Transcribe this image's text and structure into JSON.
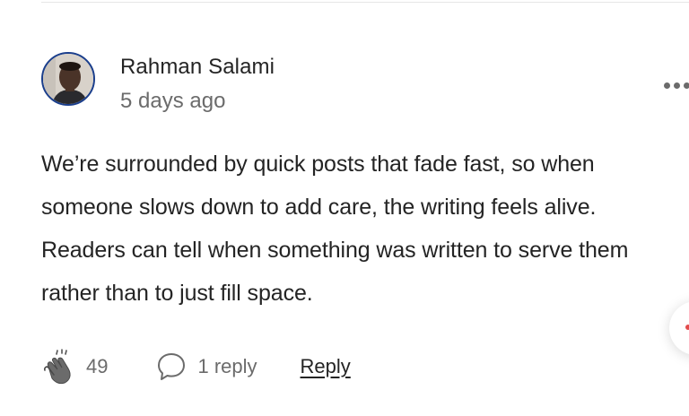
{
  "comment": {
    "author": "Rahman Salami",
    "timestamp": "5 days ago",
    "body": "We’re surrounded by quick posts that fade fast, so when someone slows down to add care, the writing feels alive. Readers can tell when something was written to serve them rather than to just fill space.",
    "avatar_icon": "avatar-photo",
    "more_icon": "ellipsis-icon"
  },
  "actions": {
    "clap_icon": "clap-icon",
    "clap_count": "49",
    "reply_icon": "speech-bubble-icon",
    "reply_count": "1 reply",
    "reply_label": "Reply"
  },
  "colors": {
    "text_primary": "#242424",
    "text_secondary": "#6b6b6b",
    "avatar_ring": "#1a3e8c"
  }
}
